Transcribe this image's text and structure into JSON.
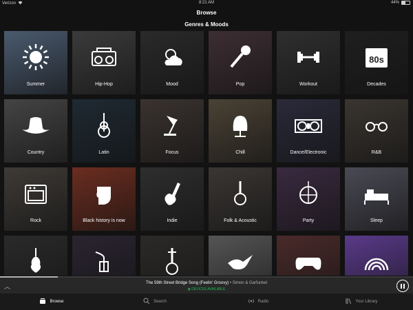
{
  "status": {
    "carrier": "Verizon",
    "time": "8:21 AM",
    "battery": "44%",
    "battery_level": 0.44
  },
  "header": {
    "title": "Browse"
  },
  "section": {
    "title": "Genres & Moods"
  },
  "tiles": [
    {
      "label": "Summer",
      "icon": "sun-icon",
      "bg": "#4a5a6e"
    },
    {
      "label": "Hip-Hop",
      "icon": "boombox-icon",
      "bg": "#3b3b3b"
    },
    {
      "label": "Mood",
      "icon": "sun-cloud-icon",
      "bg": "#2a2a2a"
    },
    {
      "label": "Pop",
      "icon": "microphone-icon",
      "bg": "#3d2e33"
    },
    {
      "label": "Workout",
      "icon": "dumbbell-icon",
      "bg": "#2f2f2f"
    },
    {
      "label": "Decades",
      "icon": "80s-calendar-icon",
      "bg": "#1f1f1f"
    },
    {
      "label": "Country",
      "icon": "cowboy-hat-icon",
      "bg": "#444444"
    },
    {
      "label": "Latin",
      "icon": "guitar-icon",
      "bg": "#1f2a33"
    },
    {
      "label": "Focus",
      "icon": "desk-lamp-icon",
      "bg": "#3a3330"
    },
    {
      "label": "Chill",
      "icon": "egg-chair-icon",
      "bg": "#4a4235"
    },
    {
      "label": "Dance/Electronic",
      "icon": "turntables-icon",
      "bg": "#2a2a3a"
    },
    {
      "label": "R&B",
      "icon": "sunglasses-icon",
      "bg": "#3a3530"
    },
    {
      "label": "Rock",
      "icon": "amplifier-icon",
      "bg": "#3e3a36"
    },
    {
      "label": "Black history is now",
      "icon": "raised-fist-icon",
      "bg": "#6b2d20"
    },
    {
      "label": "Indie",
      "icon": "electric-guitar-icon",
      "bg": "#2e2e2e"
    },
    {
      "label": "Folk & Acoustic",
      "icon": "banjo-icon",
      "bg": "#3a3633"
    },
    {
      "label": "Party",
      "icon": "disco-ball-icon",
      "bg": "#3a2a40"
    },
    {
      "label": "Sleep",
      "icon": "bed-icon",
      "bg": "#4a4a55"
    },
    {
      "label": "",
      "icon": "violin-icon",
      "bg": "#2a2a2a"
    },
    {
      "label": "",
      "icon": "trumpet-icon",
      "bg": "#2a2430"
    },
    {
      "label": "",
      "icon": "sitar-icon",
      "bg": "#2c2a28"
    },
    {
      "label": "",
      "icon": "dove-icon",
      "bg": "#555555"
    },
    {
      "label": "",
      "icon": "gamepad-icon",
      "bg": "#4a2a2a"
    },
    {
      "label": "",
      "icon": "rainbow-icon",
      "bg": "#5a3a8a"
    }
  ],
  "now_playing": {
    "title": "The 59th Street Bridge Song (Feelin' Groovy)",
    "separator": " • ",
    "artist": "Simon & Garfunkel",
    "device": "◉ DEVICES AVAILABLE"
  },
  "tabs": [
    {
      "label": "Browse",
      "icon": "browse-icon",
      "active": true
    },
    {
      "label": "Search",
      "icon": "search-icon",
      "active": false
    },
    {
      "label": "Radio",
      "icon": "radio-icon",
      "active": false
    },
    {
      "label": "Your Library",
      "icon": "library-icon",
      "active": false
    }
  ],
  "colors": {
    "accent": "#1db954",
    "background": "#121212"
  }
}
